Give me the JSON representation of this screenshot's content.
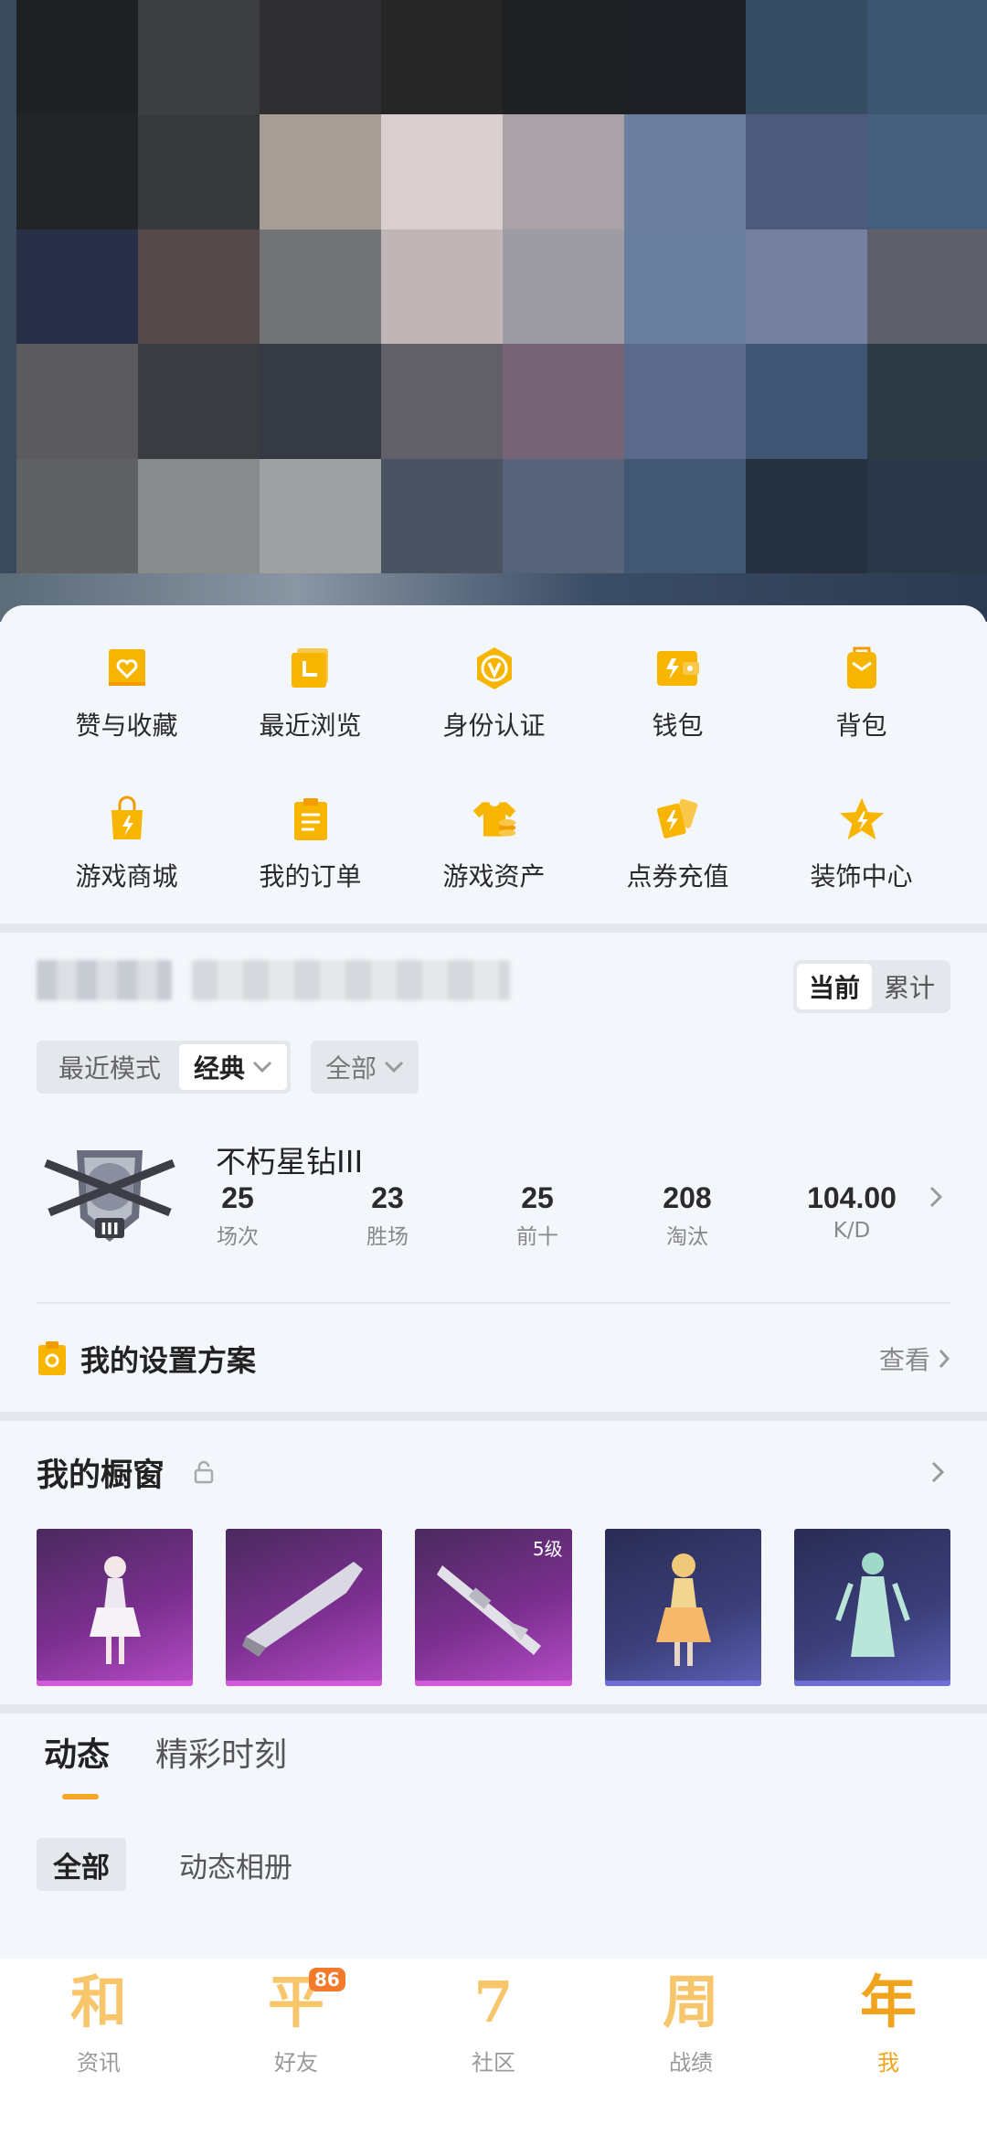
{
  "hero_tiles": [
    "#1e2224",
    "#3d3e41",
    "#2f2f31",
    "#262627",
    "#1f2023",
    "#1d2024",
    "#364c63",
    "#3c5672",
    "#222425",
    "#35393c",
    "#a69d97",
    "#d9cfcf",
    "#aba2a8",
    "#6c7f9e",
    "#4e5a7b",
    "#445e7b",
    "#283048",
    "#55494b",
    "#727375",
    "#c1b6b7",
    "#9d9ba3",
    "#6a7e9d",
    "#7580a0",
    "#5f5e6b",
    "#5b5b5d",
    "#3a3c42",
    "#363a44",
    "#62616a",
    "#766575",
    "#5b6a8c",
    "#3f5774",
    "#2d3a44",
    "#5f6162",
    "#8a8b8d",
    "#9fa0a2",
    "#4a5362",
    "#566379",
    "#425772",
    "#253041",
    "#2a3748"
  ],
  "menu": [
    {
      "label": "赞与收藏",
      "icon": "heart-card-icon"
    },
    {
      "label": "最近浏览",
      "icon": "recent-icon"
    },
    {
      "label": "身份认证",
      "icon": "verify-icon"
    },
    {
      "label": "钱包",
      "icon": "wallet-icon"
    },
    {
      "label": "背包",
      "icon": "backpack-icon"
    },
    {
      "label": "游戏商城",
      "icon": "shop-bag-icon"
    },
    {
      "label": "我的订单",
      "icon": "order-clipboard-icon"
    },
    {
      "label": "游戏资产",
      "icon": "shirt-coin-icon"
    },
    {
      "label": "点券充值",
      "icon": "ticket-cards-icon"
    },
    {
      "label": "装饰中心",
      "icon": "star-decor-icon"
    }
  ],
  "stats": {
    "toggle": {
      "current": "当前",
      "total": "累计"
    },
    "mode_label": "最近模式",
    "mode_value": "经典",
    "scope_value": "全部",
    "rank_title": "不朽星钻III",
    "items": [
      {
        "value": "25",
        "label": "场次"
      },
      {
        "value": "23",
        "label": "胜场"
      },
      {
        "value": "25",
        "label": "前十"
      },
      {
        "value": "208",
        "label": "淘汰"
      },
      {
        "value": "104.00",
        "label": "K/D"
      }
    ]
  },
  "settings": {
    "title": "我的设置方案",
    "view": "查看"
  },
  "showcase": {
    "title": "我的橱窗",
    "items": [
      {
        "style": "purple",
        "tag": "",
        "icon": "dancer-outfit-icon"
      },
      {
        "style": "purple",
        "tag": "",
        "icon": "blade-skin-icon"
      },
      {
        "style": "purple",
        "tag": "5级",
        "icon": "rifle-skin-icon"
      },
      {
        "style": "blue",
        "tag": "",
        "icon": "dress-outfit-icon"
      },
      {
        "style": "blue",
        "tag": "",
        "icon": "robe-outfit-icon"
      }
    ]
  },
  "feed": {
    "tabs": [
      "动态",
      "精彩时刻"
    ],
    "filters": [
      "全部",
      "动态相册"
    ]
  },
  "nav": [
    {
      "glyph": "和",
      "label": "资讯",
      "badge": ""
    },
    {
      "glyph": "平",
      "label": "好友",
      "badge": "86"
    },
    {
      "glyph": "7",
      "label": "社区",
      "badge": ""
    },
    {
      "glyph": "周",
      "label": "战绩",
      "badge": ""
    },
    {
      "glyph": "年",
      "label": "我",
      "badge": ""
    }
  ],
  "colors": {
    "accent": "#f5a623",
    "icon_yellow": "#f7b500",
    "badge": "#f27a2a"
  }
}
